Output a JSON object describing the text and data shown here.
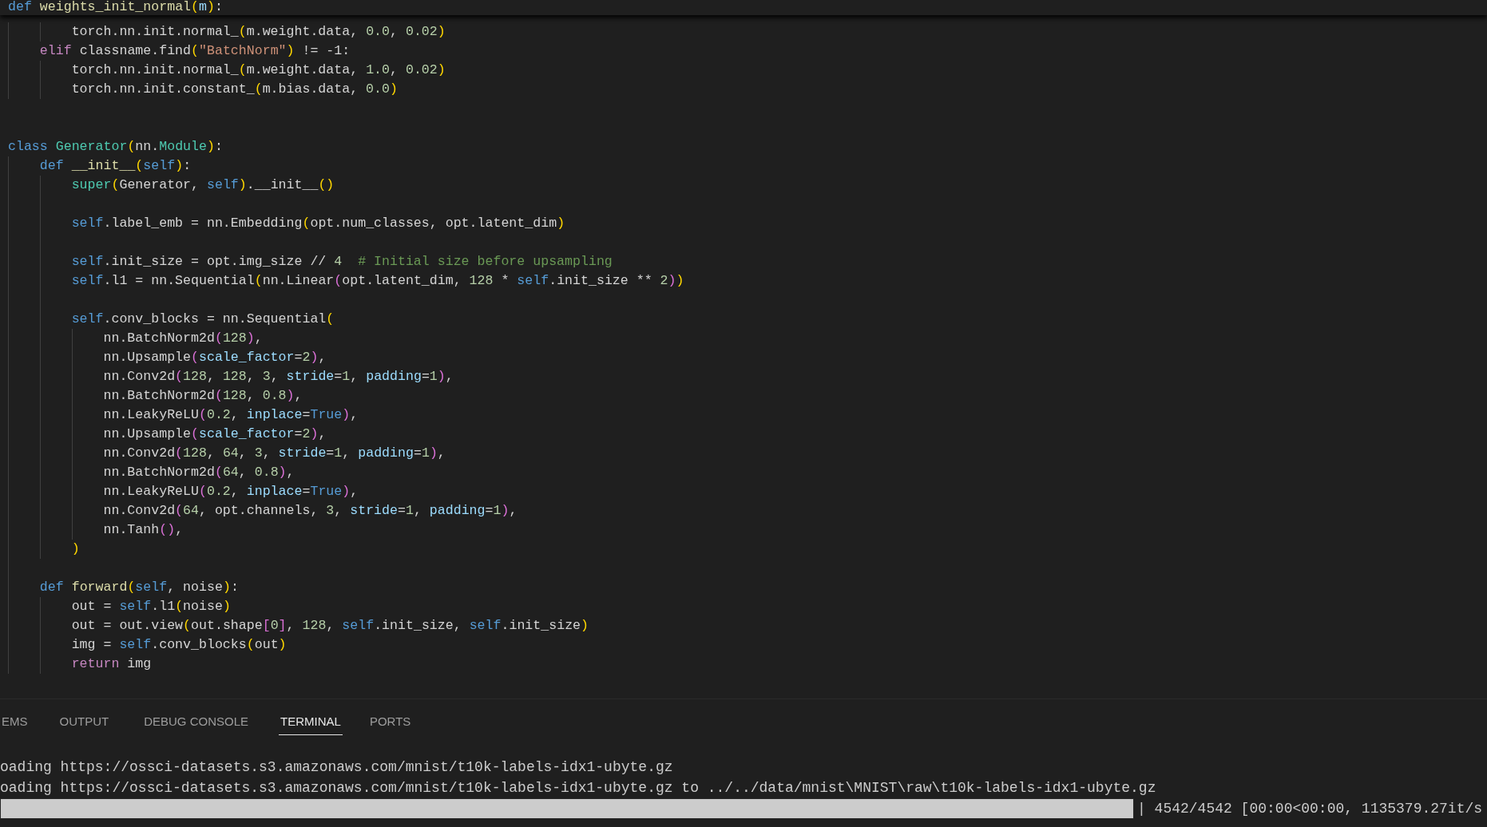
{
  "editor": {
    "sticky_header": [
      {
        "kind": "keyword",
        "text": "def "
      },
      {
        "kind": "function",
        "text": "weights_init_normal"
      },
      {
        "kind": "bracket1",
        "text": "("
      },
      {
        "kind": "param",
        "text": "m"
      },
      {
        "kind": "bracket1",
        "text": ")"
      },
      {
        "kind": "plain",
        "text": ":"
      }
    ],
    "lines": [
      {
        "kind": "group",
        "children": [
          {
            "kind": "group",
            "children": [
              {
                "kind": "code",
                "tokens": [
                  {
                    "kind": "plain",
                    "text": "torch.nn.init.normal_"
                  },
                  {
                    "kind": "bracket1",
                    "text": "("
                  },
                  {
                    "kind": "plain",
                    "text": "m.weight.data, "
                  },
                  {
                    "kind": "number",
                    "text": "0.0"
                  },
                  {
                    "kind": "plain",
                    "text": ", "
                  },
                  {
                    "kind": "number",
                    "text": "0.02"
                  },
                  {
                    "kind": "bracket1",
                    "text": ")"
                  }
                ]
              }
            ]
          },
          {
            "kind": "code",
            "tokens": [
              {
                "kind": "control",
                "text": "elif"
              },
              {
                "kind": "plain",
                "text": " classname.find"
              },
              {
                "kind": "bracket1",
                "text": "("
              },
              {
                "kind": "string",
                "text": "\"BatchNorm\""
              },
              {
                "kind": "bracket1",
                "text": ")"
              },
              {
                "kind": "plain",
                "text": " != -1:"
              }
            ],
            "children": [
              {
                "kind": "code",
                "tokens": [
                  {
                    "kind": "plain",
                    "text": "torch.nn.init.normal_"
                  },
                  {
                    "kind": "bracket1",
                    "text": "("
                  },
                  {
                    "kind": "plain",
                    "text": "m.weight.data, "
                  },
                  {
                    "kind": "number",
                    "text": "1.0"
                  },
                  {
                    "kind": "plain",
                    "text": ", "
                  },
                  {
                    "kind": "number",
                    "text": "0.02"
                  },
                  {
                    "kind": "bracket1",
                    "text": ")"
                  }
                ]
              },
              {
                "kind": "code",
                "tokens": [
                  {
                    "kind": "plain",
                    "text": "torch.nn.init.constant_"
                  },
                  {
                    "kind": "bracket1",
                    "text": "("
                  },
                  {
                    "kind": "plain",
                    "text": "m.bias.data, "
                  },
                  {
                    "kind": "number",
                    "text": "0.0"
                  },
                  {
                    "kind": "bracket1",
                    "text": ")"
                  }
                ]
              }
            ]
          }
        ]
      },
      {
        "kind": "blank"
      },
      {
        "kind": "blank"
      },
      {
        "kind": "code",
        "tokens": [
          {
            "kind": "keyword",
            "text": "class "
          },
          {
            "kind": "type",
            "text": "Generator"
          },
          {
            "kind": "bracket1",
            "text": "("
          },
          {
            "kind": "plain",
            "text": "nn."
          },
          {
            "kind": "type",
            "text": "Module"
          },
          {
            "kind": "bracket1",
            "text": ")"
          },
          {
            "kind": "plain",
            "text": ":"
          }
        ],
        "children": [
          {
            "kind": "code",
            "tokens": [
              {
                "kind": "keyword",
                "text": "def "
              },
              {
                "kind": "function",
                "text": "__init__"
              },
              {
                "kind": "bracket1",
                "text": "("
              },
              {
                "kind": "keyword",
                "text": "self"
              },
              {
                "kind": "bracket1",
                "text": ")"
              },
              {
                "kind": "plain",
                "text": ":"
              }
            ],
            "children": [
              {
                "kind": "code",
                "tokens": [
                  {
                    "kind": "type",
                    "text": "super"
                  },
                  {
                    "kind": "bracket1",
                    "text": "("
                  },
                  {
                    "kind": "plain",
                    "text": "Generator, "
                  },
                  {
                    "kind": "keyword",
                    "text": "self"
                  },
                  {
                    "kind": "bracket1",
                    "text": ")"
                  },
                  {
                    "kind": "plain",
                    "text": ".__init__"
                  },
                  {
                    "kind": "bracket1",
                    "text": "()"
                  }
                ]
              },
              {
                "kind": "blank"
              },
              {
                "kind": "code",
                "tokens": [
                  {
                    "kind": "keyword",
                    "text": "self"
                  },
                  {
                    "kind": "plain",
                    "text": ".label_emb = nn.Embedding"
                  },
                  {
                    "kind": "bracket1",
                    "text": "("
                  },
                  {
                    "kind": "plain",
                    "text": "opt.num_classes, opt.latent_dim"
                  },
                  {
                    "kind": "bracket1",
                    "text": ")"
                  }
                ]
              },
              {
                "kind": "blank"
              },
              {
                "kind": "code",
                "tokens": [
                  {
                    "kind": "keyword",
                    "text": "self"
                  },
                  {
                    "kind": "plain",
                    "text": ".init_size = opt.img_size // "
                  },
                  {
                    "kind": "number",
                    "text": "4"
                  },
                  {
                    "kind": "comment",
                    "text": "  # Initial size before upsampling"
                  }
                ]
              },
              {
                "kind": "code",
                "tokens": [
                  {
                    "kind": "keyword",
                    "text": "self"
                  },
                  {
                    "kind": "plain",
                    "text": ".l1 = nn.Sequential"
                  },
                  {
                    "kind": "bracket1",
                    "text": "("
                  },
                  {
                    "kind": "plain",
                    "text": "nn.Linear"
                  },
                  {
                    "kind": "bracket2",
                    "text": "("
                  },
                  {
                    "kind": "plain",
                    "text": "opt.latent_dim, "
                  },
                  {
                    "kind": "number",
                    "text": "128"
                  },
                  {
                    "kind": "plain",
                    "text": " * "
                  },
                  {
                    "kind": "keyword",
                    "text": "self"
                  },
                  {
                    "kind": "plain",
                    "text": ".init_size ** "
                  },
                  {
                    "kind": "number",
                    "text": "2"
                  },
                  {
                    "kind": "bracket2",
                    "text": ")"
                  },
                  {
                    "kind": "bracket1",
                    "text": ")"
                  }
                ]
              },
              {
                "kind": "blank"
              },
              {
                "kind": "code",
                "tokens": [
                  {
                    "kind": "keyword",
                    "text": "self"
                  },
                  {
                    "kind": "plain",
                    "text": ".conv_blocks = nn.Sequential"
                  },
                  {
                    "kind": "bracket1",
                    "text": "("
                  }
                ],
                "children": [
                  {
                    "kind": "code",
                    "tokens": [
                      {
                        "kind": "plain",
                        "text": "nn.BatchNorm2d"
                      },
                      {
                        "kind": "bracket2",
                        "text": "("
                      },
                      {
                        "kind": "number",
                        "text": "128"
                      },
                      {
                        "kind": "bracket2",
                        "text": ")"
                      },
                      {
                        "kind": "plain",
                        "text": ","
                      }
                    ]
                  },
                  {
                    "kind": "code",
                    "tokens": [
                      {
                        "kind": "plain",
                        "text": "nn.Upsample"
                      },
                      {
                        "kind": "bracket2",
                        "text": "("
                      },
                      {
                        "kind": "param",
                        "text": "scale_factor"
                      },
                      {
                        "kind": "plain",
                        "text": "="
                      },
                      {
                        "kind": "number",
                        "text": "2"
                      },
                      {
                        "kind": "bracket2",
                        "text": ")"
                      },
                      {
                        "kind": "plain",
                        "text": ","
                      }
                    ]
                  },
                  {
                    "kind": "code",
                    "tokens": [
                      {
                        "kind": "plain",
                        "text": "nn.Conv2d"
                      },
                      {
                        "kind": "bracket2",
                        "text": "("
                      },
                      {
                        "kind": "number",
                        "text": "128"
                      },
                      {
                        "kind": "plain",
                        "text": ", "
                      },
                      {
                        "kind": "number",
                        "text": "128"
                      },
                      {
                        "kind": "plain",
                        "text": ", "
                      },
                      {
                        "kind": "number",
                        "text": "3"
                      },
                      {
                        "kind": "plain",
                        "text": ", "
                      },
                      {
                        "kind": "param",
                        "text": "stride"
                      },
                      {
                        "kind": "plain",
                        "text": "="
                      },
                      {
                        "kind": "number",
                        "text": "1"
                      },
                      {
                        "kind": "plain",
                        "text": ", "
                      },
                      {
                        "kind": "param",
                        "text": "padding"
                      },
                      {
                        "kind": "plain",
                        "text": "="
                      },
                      {
                        "kind": "number",
                        "text": "1"
                      },
                      {
                        "kind": "bracket2",
                        "text": ")"
                      },
                      {
                        "kind": "plain",
                        "text": ","
                      }
                    ]
                  },
                  {
                    "kind": "code",
                    "tokens": [
                      {
                        "kind": "plain",
                        "text": "nn.BatchNorm2d"
                      },
                      {
                        "kind": "bracket2",
                        "text": "("
                      },
                      {
                        "kind": "number",
                        "text": "128"
                      },
                      {
                        "kind": "plain",
                        "text": ", "
                      },
                      {
                        "kind": "number",
                        "text": "0.8"
                      },
                      {
                        "kind": "bracket2",
                        "text": ")"
                      },
                      {
                        "kind": "plain",
                        "text": ","
                      }
                    ]
                  },
                  {
                    "kind": "code",
                    "tokens": [
                      {
                        "kind": "plain",
                        "text": "nn.LeakyReLU"
                      },
                      {
                        "kind": "bracket2",
                        "text": "("
                      },
                      {
                        "kind": "number",
                        "text": "0.2"
                      },
                      {
                        "kind": "plain",
                        "text": ", "
                      },
                      {
                        "kind": "param",
                        "text": "inplace"
                      },
                      {
                        "kind": "plain",
                        "text": "="
                      },
                      {
                        "kind": "keyword",
                        "text": "True"
                      },
                      {
                        "kind": "bracket2",
                        "text": ")"
                      },
                      {
                        "kind": "plain",
                        "text": ","
                      }
                    ]
                  },
                  {
                    "kind": "code",
                    "tokens": [
                      {
                        "kind": "plain",
                        "text": "nn.Upsample"
                      },
                      {
                        "kind": "bracket2",
                        "text": "("
                      },
                      {
                        "kind": "param",
                        "text": "scale_factor"
                      },
                      {
                        "kind": "plain",
                        "text": "="
                      },
                      {
                        "kind": "number",
                        "text": "2"
                      },
                      {
                        "kind": "bracket2",
                        "text": ")"
                      },
                      {
                        "kind": "plain",
                        "text": ","
                      }
                    ]
                  },
                  {
                    "kind": "code",
                    "tokens": [
                      {
                        "kind": "plain",
                        "text": "nn.Conv2d"
                      },
                      {
                        "kind": "bracket2",
                        "text": "("
                      },
                      {
                        "kind": "number",
                        "text": "128"
                      },
                      {
                        "kind": "plain",
                        "text": ", "
                      },
                      {
                        "kind": "number",
                        "text": "64"
                      },
                      {
                        "kind": "plain",
                        "text": ", "
                      },
                      {
                        "kind": "number",
                        "text": "3"
                      },
                      {
                        "kind": "plain",
                        "text": ", "
                      },
                      {
                        "kind": "param",
                        "text": "stride"
                      },
                      {
                        "kind": "plain",
                        "text": "="
                      },
                      {
                        "kind": "number",
                        "text": "1"
                      },
                      {
                        "kind": "plain",
                        "text": ", "
                      },
                      {
                        "kind": "param",
                        "text": "padding"
                      },
                      {
                        "kind": "plain",
                        "text": "="
                      },
                      {
                        "kind": "number",
                        "text": "1"
                      },
                      {
                        "kind": "bracket2",
                        "text": ")"
                      },
                      {
                        "kind": "plain",
                        "text": ","
                      }
                    ]
                  },
                  {
                    "kind": "code",
                    "tokens": [
                      {
                        "kind": "plain",
                        "text": "nn.BatchNorm2d"
                      },
                      {
                        "kind": "bracket2",
                        "text": "("
                      },
                      {
                        "kind": "number",
                        "text": "64"
                      },
                      {
                        "kind": "plain",
                        "text": ", "
                      },
                      {
                        "kind": "number",
                        "text": "0.8"
                      },
                      {
                        "kind": "bracket2",
                        "text": ")"
                      },
                      {
                        "kind": "plain",
                        "text": ","
                      }
                    ]
                  },
                  {
                    "kind": "code",
                    "tokens": [
                      {
                        "kind": "plain",
                        "text": "nn.LeakyReLU"
                      },
                      {
                        "kind": "bracket2",
                        "text": "("
                      },
                      {
                        "kind": "number",
                        "text": "0.2"
                      },
                      {
                        "kind": "plain",
                        "text": ", "
                      },
                      {
                        "kind": "param",
                        "text": "inplace"
                      },
                      {
                        "kind": "plain",
                        "text": "="
                      },
                      {
                        "kind": "keyword",
                        "text": "True"
                      },
                      {
                        "kind": "bracket2",
                        "text": ")"
                      },
                      {
                        "kind": "plain",
                        "text": ","
                      }
                    ]
                  },
                  {
                    "kind": "code",
                    "tokens": [
                      {
                        "kind": "plain",
                        "text": "nn.Conv2d"
                      },
                      {
                        "kind": "bracket2",
                        "text": "("
                      },
                      {
                        "kind": "number",
                        "text": "64"
                      },
                      {
                        "kind": "plain",
                        "text": ", opt.channels, "
                      },
                      {
                        "kind": "number",
                        "text": "3"
                      },
                      {
                        "kind": "plain",
                        "text": ", "
                      },
                      {
                        "kind": "param",
                        "text": "stride"
                      },
                      {
                        "kind": "plain",
                        "text": "="
                      },
                      {
                        "kind": "number",
                        "text": "1"
                      },
                      {
                        "kind": "plain",
                        "text": ", "
                      },
                      {
                        "kind": "param",
                        "text": "padding"
                      },
                      {
                        "kind": "plain",
                        "text": "="
                      },
                      {
                        "kind": "number",
                        "text": "1"
                      },
                      {
                        "kind": "bracket2",
                        "text": ")"
                      },
                      {
                        "kind": "plain",
                        "text": ","
                      }
                    ]
                  },
                  {
                    "kind": "code",
                    "tokens": [
                      {
                        "kind": "plain",
                        "text": "nn.Tanh"
                      },
                      {
                        "kind": "bracket2",
                        "text": "()"
                      },
                      {
                        "kind": "plain",
                        "text": ","
                      }
                    ]
                  }
                ]
              },
              {
                "kind": "code",
                "tokens": [
                  {
                    "kind": "bracket1",
                    "text": ")"
                  }
                ]
              }
            ]
          },
          {
            "kind": "blank"
          },
          {
            "kind": "code",
            "tokens": [
              {
                "kind": "keyword",
                "text": "def "
              },
              {
                "kind": "function",
                "text": "forward"
              },
              {
                "kind": "bracket1",
                "text": "("
              },
              {
                "kind": "keyword",
                "text": "self"
              },
              {
                "kind": "plain",
                "text": ", noise"
              },
              {
                "kind": "bracket1",
                "text": ")"
              },
              {
                "kind": "plain",
                "text": ":"
              }
            ],
            "children": [
              {
                "kind": "code",
                "tokens": [
                  {
                    "kind": "plain",
                    "text": "out = "
                  },
                  {
                    "kind": "keyword",
                    "text": "self"
                  },
                  {
                    "kind": "plain",
                    "text": ".l1"
                  },
                  {
                    "kind": "bracket1",
                    "text": "("
                  },
                  {
                    "kind": "plain",
                    "text": "noise"
                  },
                  {
                    "kind": "bracket1",
                    "text": ")"
                  }
                ]
              },
              {
                "kind": "code",
                "tokens": [
                  {
                    "kind": "plain",
                    "text": "out = out.view"
                  },
                  {
                    "kind": "bracket1",
                    "text": "("
                  },
                  {
                    "kind": "plain",
                    "text": "out.shape"
                  },
                  {
                    "kind": "bracket2",
                    "text": "["
                  },
                  {
                    "kind": "number",
                    "text": "0"
                  },
                  {
                    "kind": "bracket2",
                    "text": "]"
                  },
                  {
                    "kind": "plain",
                    "text": ", "
                  },
                  {
                    "kind": "number",
                    "text": "128"
                  },
                  {
                    "kind": "plain",
                    "text": ", "
                  },
                  {
                    "kind": "keyword",
                    "text": "self"
                  },
                  {
                    "kind": "plain",
                    "text": ".init_size, "
                  },
                  {
                    "kind": "keyword",
                    "text": "self"
                  },
                  {
                    "kind": "plain",
                    "text": ".init_size"
                  },
                  {
                    "kind": "bracket1",
                    "text": ")"
                  }
                ]
              },
              {
                "kind": "code",
                "tokens": [
                  {
                    "kind": "plain",
                    "text": "img = "
                  },
                  {
                    "kind": "keyword",
                    "text": "self"
                  },
                  {
                    "kind": "plain",
                    "text": ".conv_blocks"
                  },
                  {
                    "kind": "bracket1",
                    "text": "("
                  },
                  {
                    "kind": "plain",
                    "text": "out"
                  },
                  {
                    "kind": "bracket1",
                    "text": ")"
                  }
                ]
              },
              {
                "kind": "code",
                "tokens": [
                  {
                    "kind": "control",
                    "text": "return"
                  },
                  {
                    "kind": "plain",
                    "text": " img"
                  }
                ]
              }
            ]
          }
        ]
      }
    ]
  },
  "panel": {
    "tabs": [
      {
        "label": "EMS",
        "selected": false
      },
      {
        "label": "OUTPUT",
        "selected": false
      },
      {
        "label": "DEBUG CONSOLE",
        "selected": false
      },
      {
        "label": "TERMINAL",
        "selected": true
      },
      {
        "label": "PORTS",
        "selected": false
      }
    ]
  },
  "terminal": {
    "lines": [
      "oading https://ossci-datasets.s3.amazonaws.com/mnist/t10k-labels-idx1-ubyte.gz",
      "oading https://ossci-datasets.s3.amazonaws.com/mnist/t10k-labels-idx1-ubyte.gz to ../../data/mnist\\MNIST\\raw\\t10k-labels-idx1-ubyte.gz"
    ],
    "progress": {
      "level": 1,
      "text": "| 4542/4542 [00:00<00:00, 1135379.27it/s"
    }
  }
}
